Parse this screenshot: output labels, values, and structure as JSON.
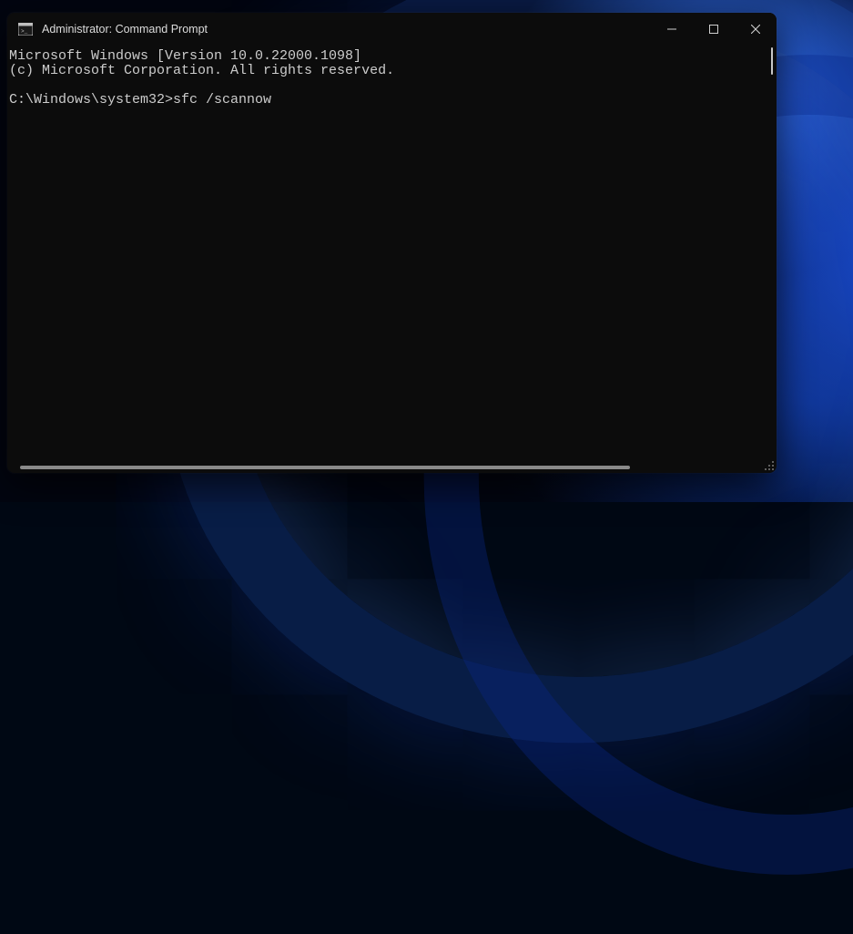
{
  "window": {
    "title": "Administrator: Command Prompt"
  },
  "terminal": {
    "line1": "Microsoft Windows [Version 10.0.22000.1098]",
    "line2": "(c) Microsoft Corporation. All rights reserved.",
    "prompt": "C:\\Windows\\system32>",
    "command": "sfc /scannow"
  }
}
